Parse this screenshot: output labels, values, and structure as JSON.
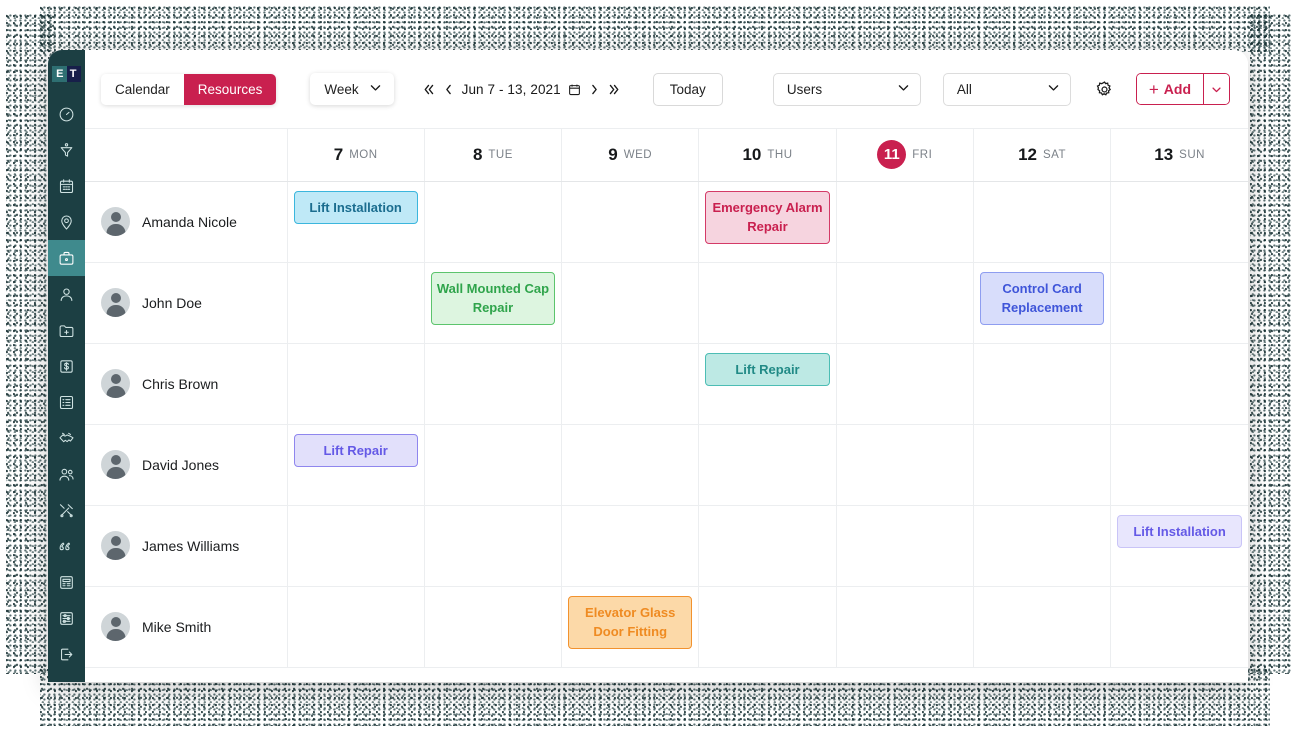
{
  "app": {
    "logo_first": "E",
    "logo_second": "T"
  },
  "sidebar": {
    "items": [
      {
        "icon": "gauge-icon",
        "name": "dashboard"
      },
      {
        "icon": "funnel-icon",
        "name": "leads"
      },
      {
        "icon": "calendar-icon",
        "name": "calendar"
      },
      {
        "icon": "map-pin-icon",
        "name": "map"
      },
      {
        "icon": "briefcase-icon",
        "name": "jobs",
        "active": true
      },
      {
        "icon": "user-icon",
        "name": "customers"
      },
      {
        "icon": "folder-plus-icon",
        "name": "projects"
      },
      {
        "icon": "dollar-icon",
        "name": "billing"
      },
      {
        "icon": "list-icon",
        "name": "tasks"
      },
      {
        "icon": "handshake-icon",
        "name": "deals"
      },
      {
        "icon": "users-group-icon",
        "name": "teams"
      },
      {
        "icon": "tools-icon",
        "name": "service"
      },
      {
        "icon": "quote-icon",
        "name": "quotes"
      },
      {
        "icon": "invoice-icon",
        "name": "invoices"
      },
      {
        "icon": "sliders-icon",
        "name": "settings"
      },
      {
        "icon": "logout-icon",
        "name": "logout"
      }
    ]
  },
  "toolbar": {
    "view_tabs": [
      {
        "label": "Calendar",
        "active": false
      },
      {
        "label": "Resources",
        "active": true
      }
    ],
    "range_select": "Week",
    "date_range": "Jun 7 - 13, 2021",
    "today_label": "Today",
    "users_filter": "Users",
    "status_filter": "All",
    "add_label": "Add",
    "accent_color": "#c9204f"
  },
  "calendar": {
    "days": [
      {
        "num": "7",
        "name": "MON",
        "today": false
      },
      {
        "num": "8",
        "name": "TUE",
        "today": false
      },
      {
        "num": "9",
        "name": "WED",
        "today": false
      },
      {
        "num": "10",
        "name": "THU",
        "today": false
      },
      {
        "num": "11",
        "name": "FRI",
        "today": true
      },
      {
        "num": "12",
        "name": "SAT",
        "today": false
      },
      {
        "num": "13",
        "name": "SUN",
        "today": false
      }
    ],
    "rows": [
      {
        "resource": "Amanda Nicole",
        "events": [
          {
            "day": 0,
            "title": "Lift Installation",
            "bg": "#bfe9f7",
            "border": "#3bb6dd",
            "fg": "#1b6d8f"
          }
        ]
      },
      {
        "resource": "John Doe",
        "events": [
          {
            "day": 1,
            "title": "Wall Mounted Cap Repair",
            "bg": "#ddf5e0",
            "border": "#5cc46d",
            "fg": "#2fa44b"
          },
          {
            "day": 5,
            "title": "Control Card Replacement",
            "bg": "#d8ddfb",
            "border": "#8e9df0",
            "fg": "#3f55d9"
          }
        ]
      },
      {
        "resource": "Chris Brown",
        "events": [
          {
            "day": 3,
            "title": "Lift Repair",
            "bg": "#bde9e4",
            "border": "#4cbdb4",
            "fg": "#218a86"
          }
        ]
      },
      {
        "resource": "David Jones",
        "events": [
          {
            "day": 0,
            "title": "Lift Repair",
            "bg": "#e2e0fb",
            "border": "#8f86ee",
            "fg": "#6459e6"
          }
        ]
      },
      {
        "resource": "James Williams",
        "events": [
          {
            "day": 6,
            "title": "Lift Installation",
            "bg": "#e8e6fd",
            "border": "#c9c4f7",
            "fg": "#6459e6"
          }
        ]
      },
      {
        "resource": "Mike Smith",
        "events": [
          {
            "day": 2,
            "title": "Elevator Glass Door Fitting",
            "bg": "#fcd9a8",
            "border": "#f2922e",
            "fg": "#ef8b22"
          }
        ]
      }
    ]
  },
  "emergency_event": {
    "title": "Emergency Alarm Repair",
    "bg": "#f6d4df",
    "border": "#d43a67",
    "fg": "#c9204f"
  }
}
